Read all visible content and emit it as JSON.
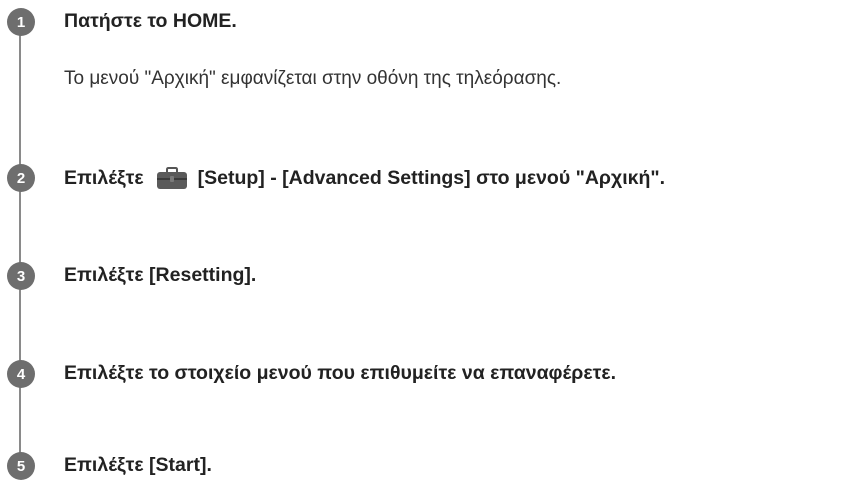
{
  "steps": [
    {
      "number": "1",
      "title": "Πατήστε το HOME.",
      "description": "Το μενού \"Αρχική\" εμφανίζεται στην οθόνη της τηλεόρασης."
    },
    {
      "number": "2",
      "title_before": "Επιλέξτε",
      "icon": "toolbox-icon",
      "title_after": "[Setup] - [Advanced Settings] στο μενού \"Αρχική\"."
    },
    {
      "number": "3",
      "title": "Επιλέξτε [Resetting]."
    },
    {
      "number": "4",
      "title": "Επιλέξτε το στοιχείο μενού που επιθυμείτε να επαναφέρετε."
    },
    {
      "number": "5",
      "title": "Επιλέξτε [Start]."
    }
  ],
  "colors": {
    "badge": "#6e6e6e",
    "rail": "#8a8a8a",
    "text": "#222222"
  }
}
